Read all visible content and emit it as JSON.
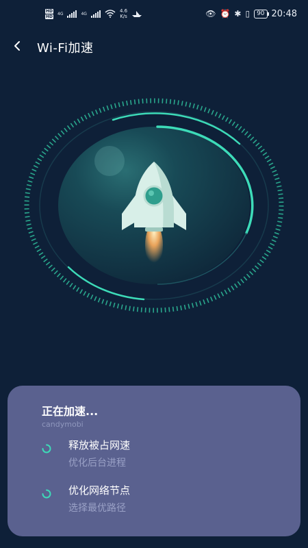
{
  "status_bar": {
    "hd_labels": [
      "HD",
      "HD"
    ],
    "network_labels": [
      "4G",
      "4G"
    ],
    "speed_value": "4.6",
    "speed_unit": "K/s",
    "battery": "90",
    "time": "20:48"
  },
  "header": {
    "back_icon": "chevron-left-icon",
    "title": "Wi-Fi加速"
  },
  "colors": {
    "background": "#0e2038",
    "accent": "#3ddbb8",
    "card": "#5a618f"
  },
  "progress_card": {
    "title": "正在加速...",
    "subtitle": "candymobi",
    "tasks": [
      {
        "icon": "loading-spinner-icon",
        "name": "释放被占网速",
        "description": "优化后台进程"
      },
      {
        "icon": "loading-spinner-icon",
        "name": "优化网络节点",
        "description": "选择最优路径"
      }
    ]
  }
}
